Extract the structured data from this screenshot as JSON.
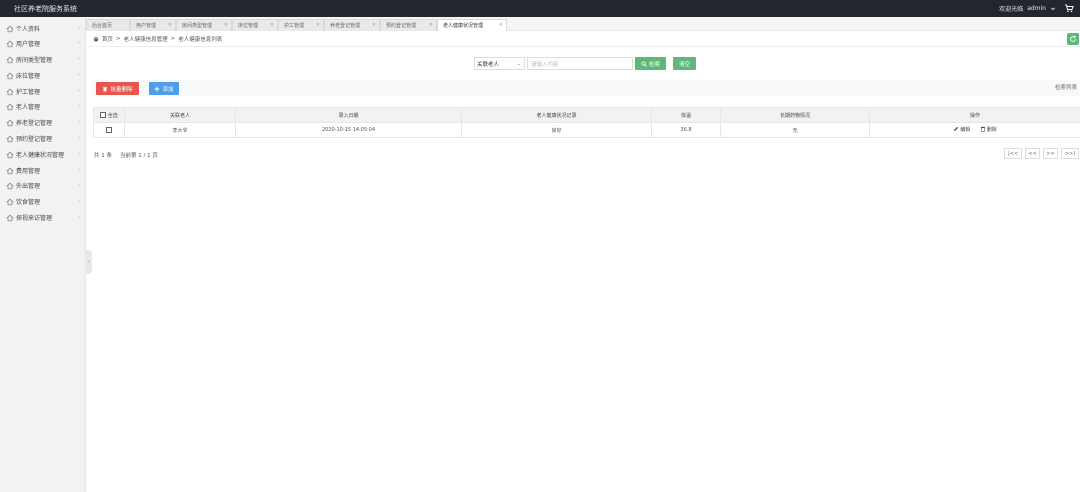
{
  "app": {
    "title": "社区养老院服务系统",
    "welcome": "欢迎光临",
    "username": "admin"
  },
  "sidebar": {
    "items": [
      {
        "label": "个人资料"
      },
      {
        "label": "用户管理"
      },
      {
        "label": "房间类型管理"
      },
      {
        "label": "床位管理"
      },
      {
        "label": "护工管理"
      },
      {
        "label": "老人管理"
      },
      {
        "label": "养老登记管理"
      },
      {
        "label": "预约登记管理"
      },
      {
        "label": "老人健康状况管理"
      },
      {
        "label": "费用管理"
      },
      {
        "label": "外出管理"
      },
      {
        "label": "饮食管理"
      },
      {
        "label": "探视来访管理"
      }
    ]
  },
  "tabs": [
    {
      "label": "后台首页"
    },
    {
      "label": "用户管理"
    },
    {
      "label": "房间类型管理"
    },
    {
      "label": "床位管理"
    },
    {
      "label": "护工管理"
    },
    {
      "label": "养老登记管理"
    },
    {
      "label": "预约登记管理"
    },
    {
      "label": "老人健康状况管理"
    }
  ],
  "breadcrumb": {
    "home": "首页",
    "section": "老人健康信息管理",
    "page": "老人健康信息列表"
  },
  "search": {
    "field_selected": "关联老人",
    "placeholder": "请输入内容",
    "search_label": "检索",
    "reset_label": "清空"
  },
  "toolbar": {
    "batch_delete_label": "批量删除",
    "add_label": "添加",
    "list_title": "检索列表"
  },
  "table": {
    "headers": [
      "全选",
      "关联老人",
      "录入日期",
      "老人健康状况记录",
      "体温",
      "长期药物情况",
      "操作"
    ],
    "rows": [
      {
        "elder": "李大爷",
        "date": "2020-10-15 14:05:04",
        "health": "良好",
        "temperature": "36.8",
        "medication": "无",
        "edit": "编辑",
        "delete": "删除"
      }
    ]
  },
  "pagination": {
    "total": "共 1 条",
    "current": "当前第 1 / 1 页",
    "first": "|<<",
    "prev": "<<",
    "next": ">>",
    "last": ">>|"
  },
  "colors": {
    "topbar": "#23262e",
    "green": "#5fb878",
    "red": "#e8564e",
    "blue": "#4e9ee8"
  },
  "icons": {
    "home": "home-icon",
    "refresh": "refresh-icon",
    "search": "search-icon",
    "trash": "trash-icon",
    "plus": "plus-icon",
    "edit": "pencil-icon",
    "delete": "trash-icon",
    "cart": "cart-icon",
    "user_chevron": "chevron-down-icon"
  }
}
